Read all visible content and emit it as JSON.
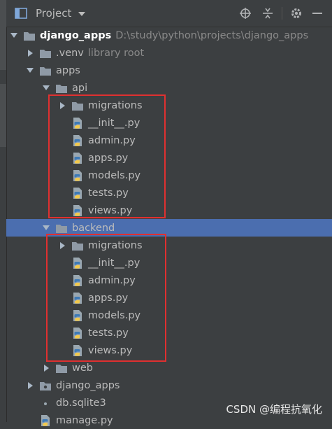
{
  "toolbar": {
    "title": "Project"
  },
  "tree": [
    {
      "name": "django_apps",
      "hint": "D:\\study\\python\\projects\\django_apps",
      "level": 0,
      "arrow": "down",
      "icon": "folder-icon",
      "root": true
    },
    {
      "name": ".venv",
      "hint": "library root",
      "level": 1,
      "arrow": "right",
      "icon": "folder-icon"
    },
    {
      "name": "apps",
      "level": 1,
      "arrow": "down",
      "icon": "folder-icon"
    },
    {
      "name": "api",
      "level": 2,
      "arrow": "down",
      "icon": "folder-icon"
    },
    {
      "name": "migrations",
      "level": 3,
      "arrow": "right",
      "icon": "folder-icon"
    },
    {
      "name": "__init__.py",
      "level": 3,
      "arrow": "none",
      "icon": "python-file-icon"
    },
    {
      "name": "admin.py",
      "level": 3,
      "arrow": "none",
      "icon": "python-file-icon"
    },
    {
      "name": "apps.py",
      "level": 3,
      "arrow": "none",
      "icon": "python-file-icon"
    },
    {
      "name": "models.py",
      "level": 3,
      "arrow": "none",
      "icon": "python-file-icon"
    },
    {
      "name": "tests.py",
      "level": 3,
      "arrow": "none",
      "icon": "python-file-icon"
    },
    {
      "name": "views.py",
      "level": 3,
      "arrow": "none",
      "icon": "python-file-icon"
    },
    {
      "name": "backend",
      "level": 2,
      "arrow": "down",
      "icon": "folder-icon",
      "selected": true
    },
    {
      "name": "migrations",
      "level": 3,
      "arrow": "right",
      "icon": "folder-icon"
    },
    {
      "name": "__init__.py",
      "level": 3,
      "arrow": "none",
      "icon": "python-file-icon"
    },
    {
      "name": "admin.py",
      "level": 3,
      "arrow": "none",
      "icon": "python-file-icon"
    },
    {
      "name": "apps.py",
      "level": 3,
      "arrow": "none",
      "icon": "python-file-icon"
    },
    {
      "name": "models.py",
      "level": 3,
      "arrow": "none",
      "icon": "python-file-icon"
    },
    {
      "name": "tests.py",
      "level": 3,
      "arrow": "none",
      "icon": "python-file-icon"
    },
    {
      "name": "views.py",
      "level": 3,
      "arrow": "none",
      "icon": "python-file-icon"
    },
    {
      "name": "web",
      "level": 2,
      "arrow": "right",
      "icon": "folder-icon"
    },
    {
      "name": "django_apps",
      "level": 1,
      "arrow": "right",
      "icon": "package-folder-icon"
    },
    {
      "name": "db.sqlite3",
      "level": 1,
      "arrow": "none",
      "icon": "file-icon"
    },
    {
      "name": "manage.py",
      "level": 1,
      "arrow": "none",
      "icon": "python-file-icon"
    }
  ],
  "watermark": "CSDN @编程抗氧化",
  "colors": {
    "background": "#3c3f41",
    "selection": "#4b6eaf",
    "highlight_box": "#e03030",
    "folder": "#8f9aa6",
    "python_blue": "#3d7ab7",
    "python_yellow": "#f2c94c"
  }
}
